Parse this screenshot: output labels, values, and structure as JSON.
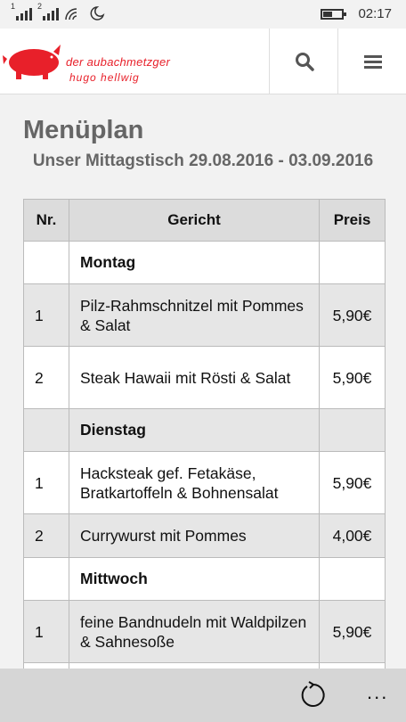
{
  "status": {
    "signal1": "1",
    "signal2": "2",
    "time": "02:17"
  },
  "header": {
    "logo_line1": "der aubachmetzger",
    "logo_line2": "hugo hellwig",
    "brand_color": "#e8202a"
  },
  "page": {
    "title": "Menüplan",
    "subtitle": "Unser Mittagstisch 29.08.2016 - 03.09.2016"
  },
  "table": {
    "headers": [
      "Nr.",
      "Gericht",
      "Preis"
    ],
    "rows": [
      {
        "type": "day",
        "nr": "",
        "dish": "Montag",
        "price": ""
      },
      {
        "type": "dish",
        "nr": "1",
        "dish": "Pilz-Rahmschnitzel mit Pommes & Salat",
        "price": "5,90€"
      },
      {
        "type": "dish",
        "nr": "2",
        "dish": "Steak Hawaii mit Rösti & Salat",
        "price": "5,90€"
      },
      {
        "type": "day",
        "nr": "",
        "dish": "Dienstag",
        "price": ""
      },
      {
        "type": "dish",
        "nr": "1",
        "dish": "Hacksteak gef. Fetakäse, Bratkartoffeln & Bohnensalat",
        "price": "5,90€"
      },
      {
        "type": "dish",
        "nr": "2",
        "dish": "Currywurst mit Pommes",
        "price": "4,00€"
      },
      {
        "type": "day",
        "nr": "",
        "dish": "Mittwoch",
        "price": ""
      },
      {
        "type": "dish",
        "nr": "1",
        "dish": "feine Bandnudeln mit Waldpilzen & Sahnesoße",
        "price": "5,90€"
      }
    ]
  },
  "bottombar": {
    "more_label": "..."
  },
  "icons": {
    "search": "search-icon",
    "menu": "hamburger-menu-icon",
    "refresh": "refresh-icon"
  }
}
